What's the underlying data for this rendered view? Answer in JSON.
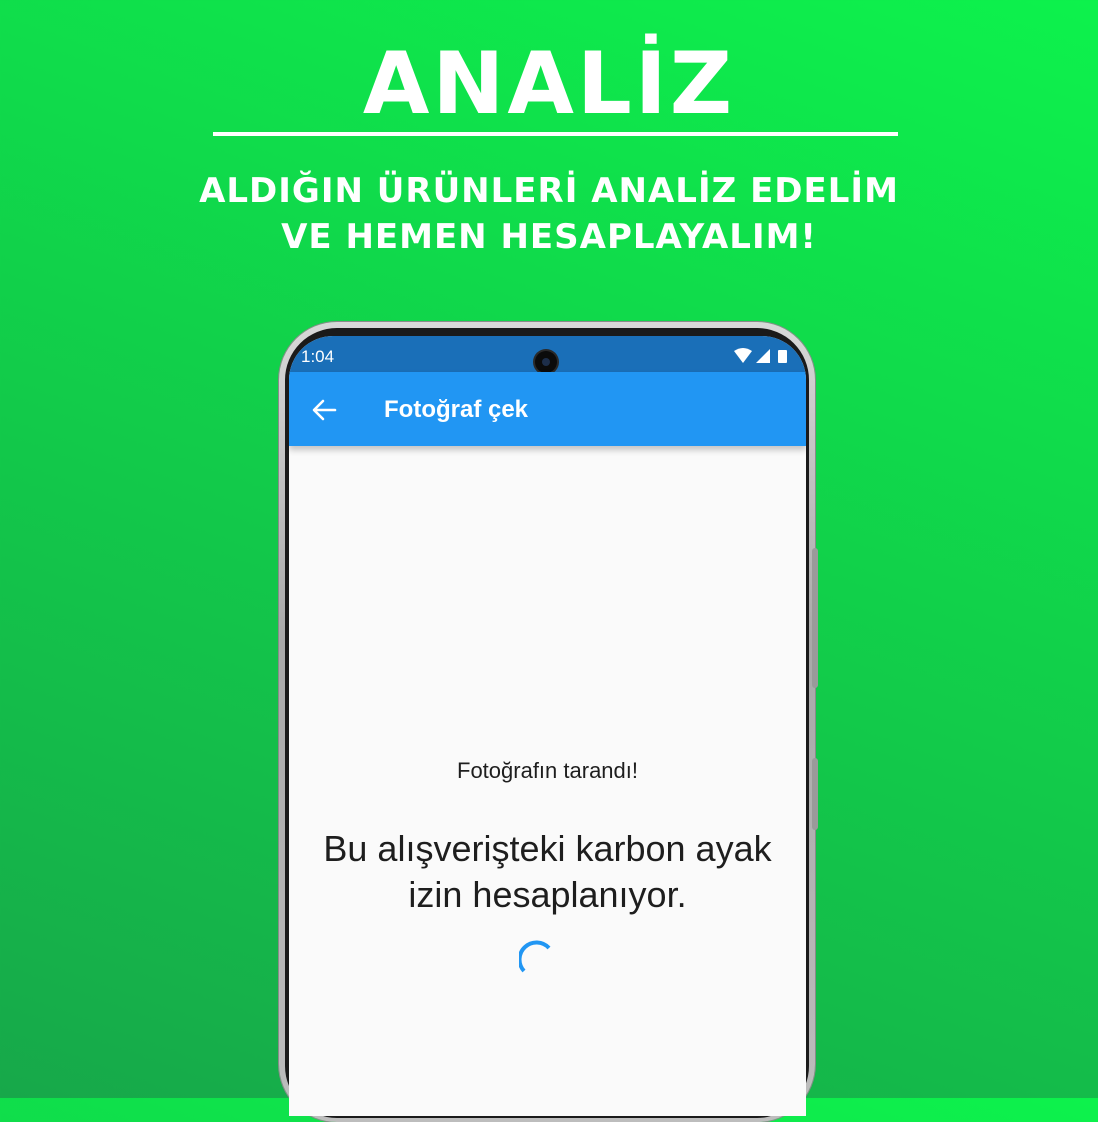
{
  "promo": {
    "headline": "ANALİZ",
    "subline_1": "ALDIĞIN ÜRÜNLERİ ANALİZ EDELİM",
    "subline_2": "VE HEMEN HESAPLAYALIM!",
    "background_color": "#12c94a",
    "text_color": "#ffffff"
  },
  "status_bar": {
    "time": "1:04",
    "icons": [
      "wifi-icon",
      "signal-icon",
      "battery-icon"
    ],
    "color": "#1a6fb8"
  },
  "app_bar": {
    "back_icon": "arrow-left-icon",
    "title": "Fotoğraf çek",
    "color": "#2196f3"
  },
  "content": {
    "scan_message": "Fotoğrafın tarandı!",
    "calc_line_1": "Bu alışverişteki karbon ayak",
    "calc_line_2": "izin hesaplanıyor.",
    "spinner_color": "#2196f3"
  }
}
